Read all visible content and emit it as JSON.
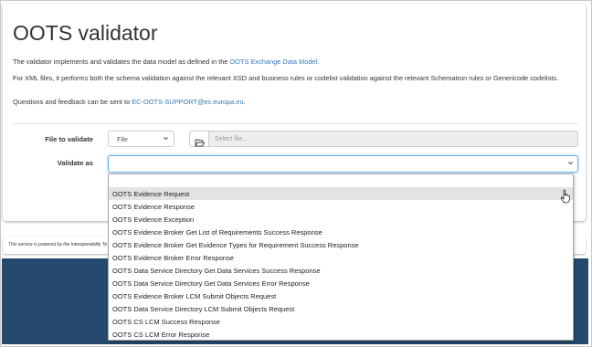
{
  "page": {
    "title": "OOTS validator",
    "intro": {
      "p1_prefix": "The validator implements and validates the data model as defined in the ",
      "p1_link": "OOTS Exchange Data Model",
      "p1_suffix": ".",
      "p2": "For XML files, it performs both the schema validation against the relevant XSD and business rules or codelist validation against the relevant Schematron rules or Genericode codelists.",
      "p3_prefix": "Questions and feedback can be sent to ",
      "p3_link": "EC-OOTS-SUPPORT@ec.europa.eu",
      "p3_suffix": "."
    }
  },
  "form": {
    "file_label": "File to validate",
    "file_type_value": "File",
    "file_placeholder": "Select file...",
    "validate_label": "Validate as",
    "validate_value": ""
  },
  "footer": {
    "text": "This service is powered by the Interoperability Test Bed."
  },
  "dropdown": {
    "options": [
      "",
      "OOTS Evidence Request",
      "OOTS Evidence Response",
      "OOTS Evidence Exception",
      "OOTS Evidence Broker Get List of Requirements Success Response",
      "OOTS Evidence Broker Get Evidence Types for Requirement Success Response",
      "OOTS Evidence Broker Error Response",
      "OOTS Data Service Directory Get Data Services Success Response",
      "OOTS Data Service Directory Get Data Services Error Response",
      "OOTS Evidence Broker LCM Submit Objects Request",
      "OOTS Data Service Directory LCM Submit Objects Request",
      "OOTS CS LCM Success Response",
      "OOTS CS LCM Error Response"
    ],
    "highlighted_index": 1
  },
  "colors": {
    "link": "#337ab7",
    "background_bottom": "#254a6e",
    "focus_border": "#66afe9"
  }
}
